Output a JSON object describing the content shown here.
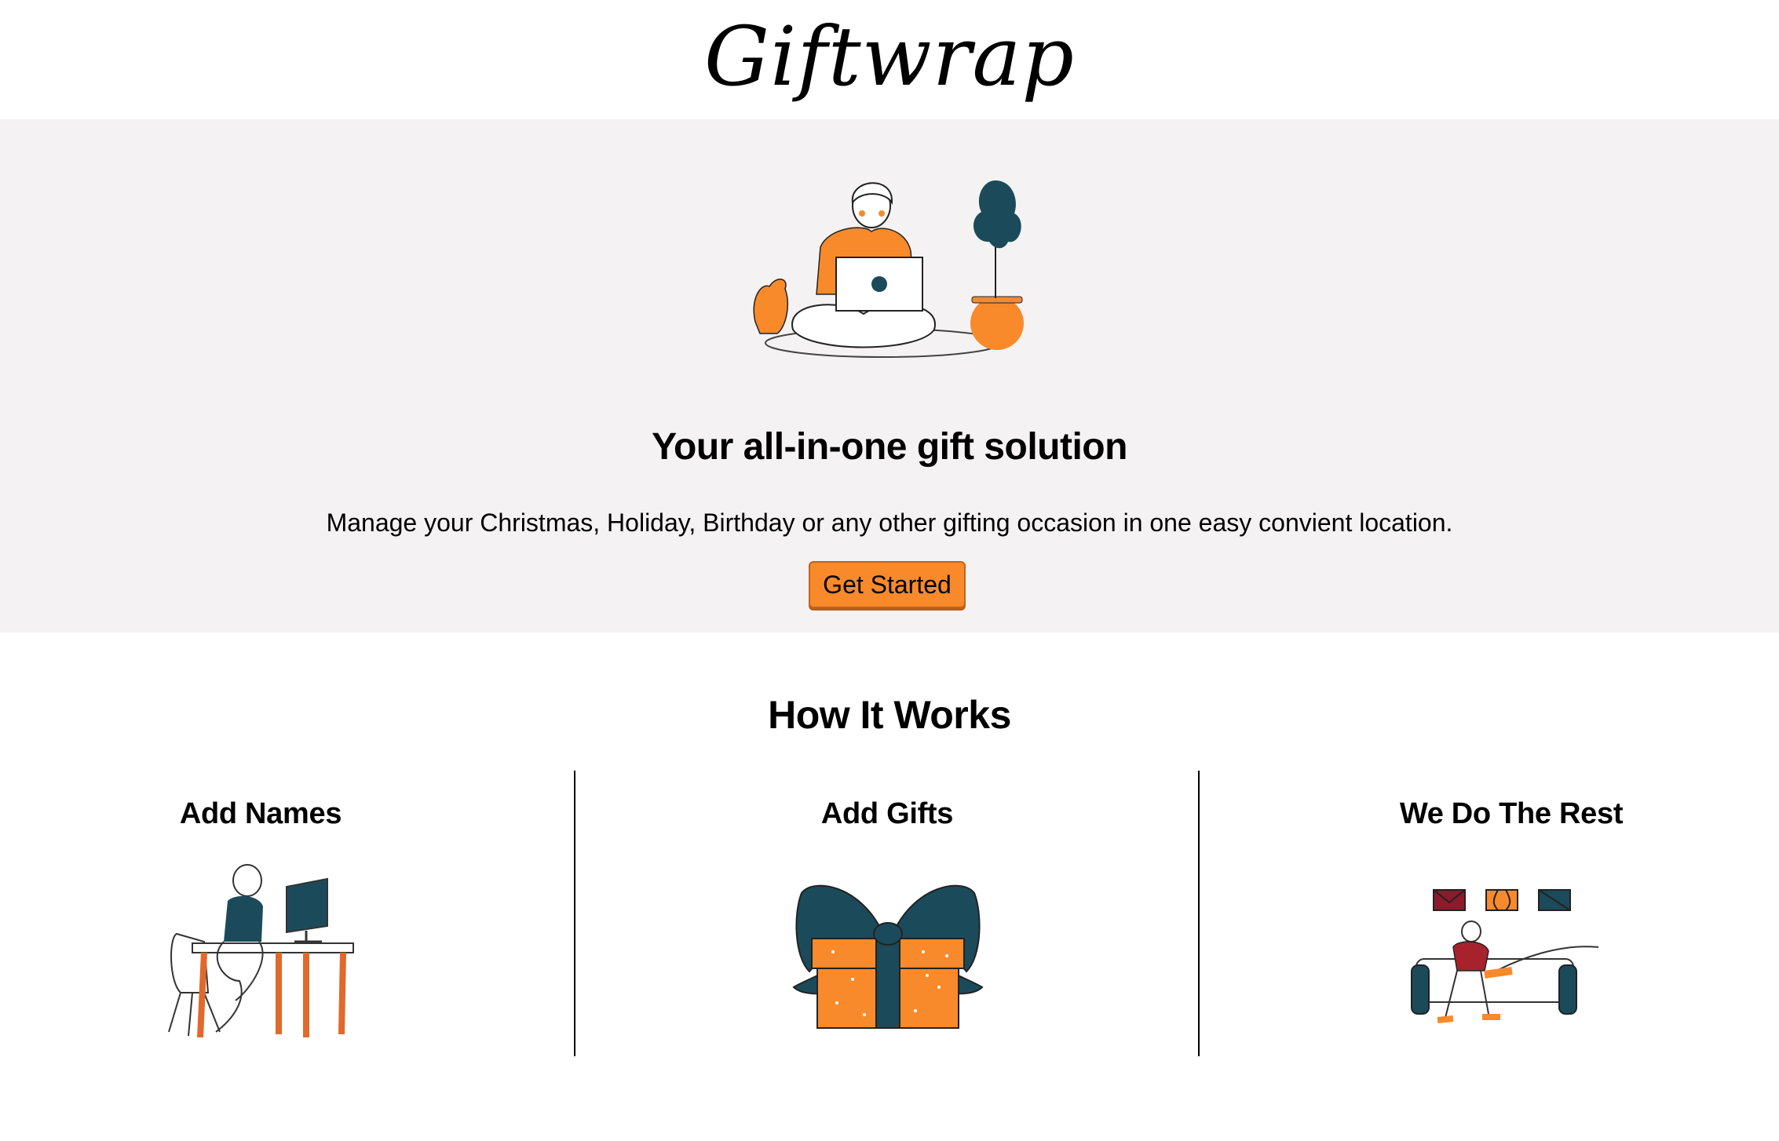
{
  "header": {
    "logo_text": "Giftwrap"
  },
  "hero": {
    "title": "Your all-in-one gift solution",
    "subtitle": "Manage your Christmas, Holiday, Birthday or any other gifting occasion in one easy convient location.",
    "cta_label": "Get Started"
  },
  "how_it_works": {
    "title": "How It Works",
    "steps": [
      {
        "title": "Add Names"
      },
      {
        "title": "Add Gifts"
      },
      {
        "title": "We Do The Rest"
      }
    ]
  },
  "colors": {
    "accent_orange": "#f88a2c",
    "dark_teal": "#1b4b5a",
    "hero_background": "#f4f2f2",
    "envelope_red": "#8c1a2a"
  }
}
